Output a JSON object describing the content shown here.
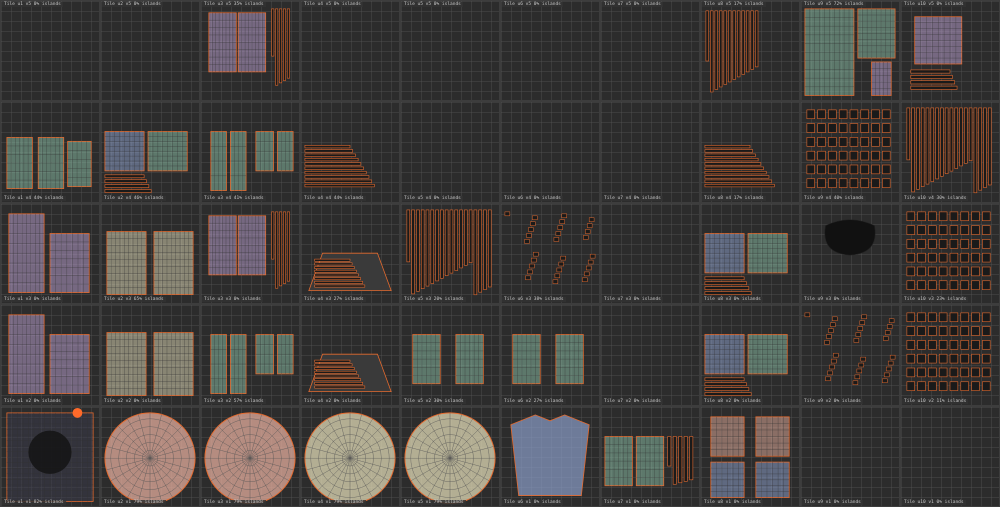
{
  "viewport": {
    "colors": {
      "background": "#2a2a2a",
      "grid_line": "#3d3d3d",
      "uv_edge": "#e46a2e",
      "uv_fill_blue": "#8a9cc7",
      "uv_fill_green": "#86b8a0",
      "uv_fill_cream": "#d6cfae",
      "uv_fill_pink": "#d8a596",
      "uv_fill_purple": "#b59bc8"
    },
    "tiles": [
      {
        "label": "Tile u1 v5 0% islands",
        "art": "empty"
      },
      {
        "label": "Tile u2 v5 0% islands",
        "art": "empty"
      },
      {
        "label": "Tile u3 v5 35% islands",
        "art": "pants"
      },
      {
        "label": "Tile u4 v5 0% islands",
        "art": "empty"
      },
      {
        "label": "Tile u5 v5 0% islands",
        "art": "empty"
      },
      {
        "label": "Tile u6 v5 0% islands",
        "art": "empty"
      },
      {
        "label": "Tile u7 v5 0% islands",
        "art": "empty"
      },
      {
        "label": "Tile u8 v5 17% islands",
        "art": "strips"
      },
      {
        "label": "Tile u9 v5 72% islands",
        "art": "jacket"
      },
      {
        "label": "Tile u10 v5 0% islands",
        "art": "vest"
      },
      {
        "label": "Tile u1 v4 44% islands",
        "art": "armor"
      },
      {
        "label": "Tile u2 v4 46% islands",
        "art": "blocks"
      },
      {
        "label": "Tile u3 v4 41% islands",
        "art": "sleeves"
      },
      {
        "label": "Tile u4 v4 44% islands",
        "art": "bars"
      },
      {
        "label": "Tile u5 v4 0% islands",
        "art": "empty"
      },
      {
        "label": "Tile u6 v4 0% islands",
        "art": "empty"
      },
      {
        "label": "Tile u7 v4 0% islands",
        "art": "empty"
      },
      {
        "label": "Tile u8 v4 17% islands",
        "art": "bars"
      },
      {
        "label": "Tile u9 v4 40% islands",
        "art": "dense"
      },
      {
        "label": "Tile u10 v4 30% islands",
        "art": "stripsdense"
      },
      {
        "label": "Tile u1 v3 0% islands",
        "art": "coat"
      },
      {
        "label": "Tile u2 v3 65% islands",
        "art": "panels"
      },
      {
        "label": "Tile u3 v3 0% islands",
        "art": "pants"
      },
      {
        "label": "Tile u4 v3 27% islands",
        "art": "trapezoid"
      },
      {
        "label": "Tile u5 v3 20% islands",
        "art": "stripsdense"
      },
      {
        "label": "Tile u6 v3 38% islands",
        "art": "scatter"
      },
      {
        "label": "Tile u7 v3 0% islands",
        "art": "empty"
      },
      {
        "label": "Tile u8 v3 0% islands",
        "art": "blocks"
      },
      {
        "label": "Tile u9 v3 0% islands",
        "art": "mask"
      },
      {
        "label": "Tile u10 v3 23% islands",
        "art": "dense"
      },
      {
        "label": "Tile u1 v2 0% islands",
        "art": "coat"
      },
      {
        "label": "Tile u2 v2 0% islands",
        "art": "panels"
      },
      {
        "label": "Tile u3 v2 57% islands",
        "art": "sleeves"
      },
      {
        "label": "Tile u4 v2 0% islands",
        "art": "trapezoid"
      },
      {
        "label": "Tile u5 v2 30% islands",
        "art": "boots"
      },
      {
        "label": "Tile u6 v2 27% islands",
        "art": "boots"
      },
      {
        "label": "Tile u7 v2 0% islands",
        "art": "empty"
      },
      {
        "label": "Tile u8 v2 0% islands",
        "art": "blocks"
      },
      {
        "label": "Tile u9 v2 0% islands",
        "art": "scatter"
      },
      {
        "label": "Tile u10 v2 11% islands",
        "art": "dense"
      },
      {
        "label": "Tile u1 v1 82% islands",
        "art": "face"
      },
      {
        "label": "Tile u2 v1 79% islands",
        "art": "disc"
      },
      {
        "label": "Tile u3 v1 79% islands",
        "art": "disc"
      },
      {
        "label": "Tile u4 v1 79% islands",
        "art": "disccream"
      },
      {
        "label": "Tile u5 v1 79% islands",
        "art": "disccream"
      },
      {
        "label": "Tile u6 v1 0% islands",
        "art": "shirt"
      },
      {
        "label": "Tile u7 v1 0% islands",
        "art": "misc"
      },
      {
        "label": "Tile u8 v1 0% islands",
        "art": "hands"
      },
      {
        "label": "Tile u9 v1 0% islands",
        "art": "empty"
      },
      {
        "label": "Tile u10 v1 0% islands",
        "art": "empty"
      }
    ]
  }
}
